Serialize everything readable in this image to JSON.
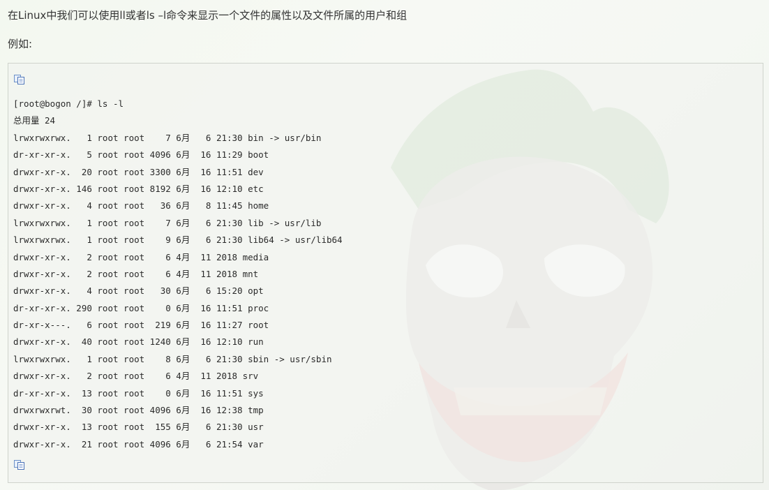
{
  "article": {
    "intro": "在Linux中我们可以使用ll或者ls –l命令来显示一个文件的属性以及文件所属的用户和组",
    "example_label": "例如:"
  },
  "code_block": {
    "copy_icon": "copy-code-icon",
    "lines": [
      "[root@bogon /]# ls -l",
      "总用量 24",
      "lrwxrwxrwx.   1 root root    7 6月   6 21:30 bin -> usr/bin",
      "dr-xr-xr-x.   5 root root 4096 6月  16 11:29 boot",
      "drwxr-xr-x.  20 root root 3300 6月  16 11:51 dev",
      "drwxr-xr-x. 146 root root 8192 6月  16 12:10 etc",
      "drwxr-xr-x.   4 root root   36 6月   8 11:45 home",
      "lrwxrwxrwx.   1 root root    7 6月   6 21:30 lib -> usr/lib",
      "lrwxrwxrwx.   1 root root    9 6月   6 21:30 lib64 -> usr/lib64",
      "drwxr-xr-x.   2 root root    6 4月  11 2018 media",
      "drwxr-xr-x.   2 root root    6 4月  11 2018 mnt",
      "drwxr-xr-x.   4 root root   30 6月   6 15:20 opt",
      "dr-xr-xr-x. 290 root root    0 6月  16 11:51 proc",
      "dr-xr-x---.   6 root root  219 6月  16 11:27 root",
      "drwxr-xr-x.  40 root root 1240 6月  16 12:10 run",
      "lrwxrwxrwx.   1 root root    8 6月   6 21:30 sbin -> usr/sbin",
      "drwxr-xr-x.   2 root root    6 4月  11 2018 srv",
      "dr-xr-xr-x.  13 root root    0 6月  16 11:51 sys",
      "drwxrwxrwt.  30 root root 4096 6月  16 12:38 tmp",
      "drwxr-xr-x.  13 root root  155 6月   6 21:30 usr",
      "drwxr-xr-x.  21 root root 4096 6月   6 21:54 var"
    ]
  }
}
